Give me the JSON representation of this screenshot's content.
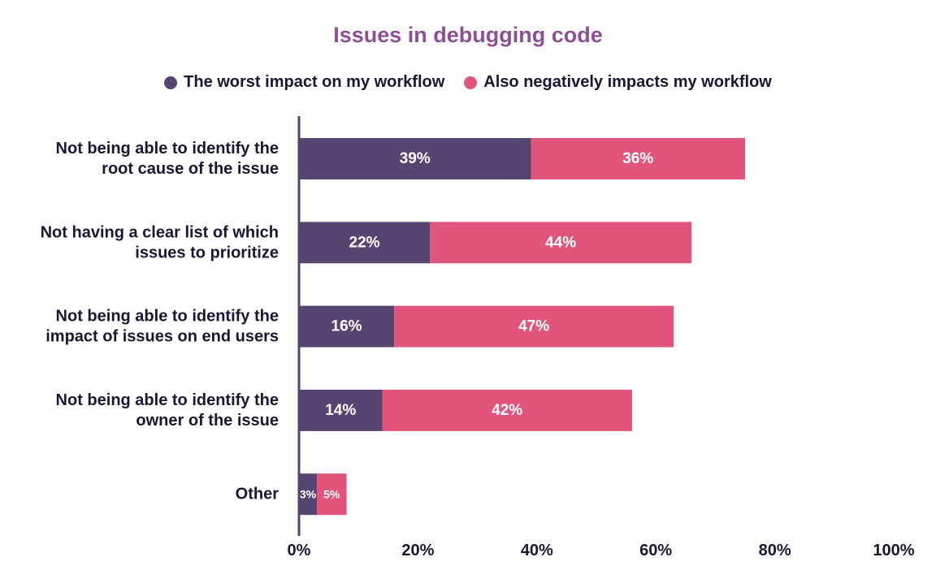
{
  "chart_data": {
    "type": "bar",
    "orientation": "horizontal",
    "stacked": true,
    "title": "Issues in debugging code",
    "xlabel": "",
    "ylabel": "",
    "xlim": [
      0,
      100
    ],
    "x_ticks": [
      "0%",
      "20%",
      "40%",
      "60%",
      "80%",
      "100%"
    ],
    "x_tick_values": [
      0,
      20,
      40,
      60,
      80,
      100
    ],
    "grid": false,
    "legend_position": "top-center",
    "categories": [
      [
        "Not being able to identify the",
        "root cause of the issue"
      ],
      [
        "Not having a clear list of which",
        "issues to prioritize"
      ],
      [
        "Not being able to identify the",
        "impact of issues on end users"
      ],
      [
        "Not being able to identify the",
        "owner of the issue"
      ],
      [
        "Other"
      ]
    ],
    "series": [
      {
        "name": "The worst impact on my workflow",
        "color": "#574571",
        "values": [
          39,
          22,
          16,
          14,
          3
        ]
      },
      {
        "name": "Also negatively impacts my workflow",
        "color": "#e1557c",
        "values": [
          36,
          44,
          47,
          42,
          5
        ]
      }
    ],
    "value_suffix": "%"
  }
}
